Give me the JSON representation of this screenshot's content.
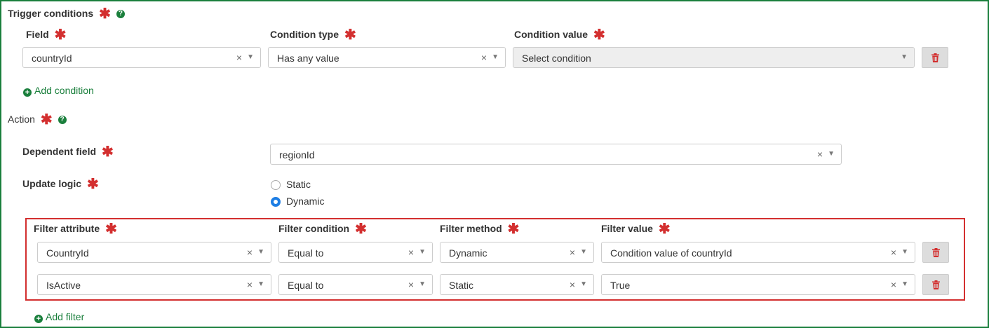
{
  "trigger": {
    "title": "Trigger conditions",
    "required_mark": "✱",
    "help_icon": "question-circle-icon",
    "columns": {
      "field": "Field",
      "condition_type": "Condition type",
      "condition_value": "Condition value"
    },
    "row": {
      "field": "countryId",
      "condition_type": "Has any value",
      "condition_value_placeholder": "Select condition"
    },
    "add_condition": "Add condition"
  },
  "action": {
    "title": "Action",
    "dependent_field_label": "Dependent field",
    "dependent_field_value": "regionId",
    "update_logic_label": "Update logic",
    "update_logic_options": [
      "Static",
      "Dynamic"
    ],
    "update_logic_selected": "Dynamic"
  },
  "filters": {
    "columns": {
      "attribute": "Filter attribute",
      "condition": "Filter condition",
      "method": "Filter method",
      "value": "Filter value"
    },
    "rows": [
      {
        "attribute": "CountryId",
        "condition": "Equal to",
        "method": "Dynamic",
        "value": "Condition value of countryId"
      },
      {
        "attribute": "IsActive",
        "condition": "Equal to",
        "method": "Static",
        "value": "True"
      }
    ],
    "add_filter": "Add filter"
  },
  "glyphs": {
    "clear": "×",
    "caret": "▼",
    "plus": "+",
    "help": "?"
  },
  "colors": {
    "accent_green": "#1a7f3c",
    "required_red": "#d32f2f",
    "radio_blue": "#1e7ee4"
  }
}
